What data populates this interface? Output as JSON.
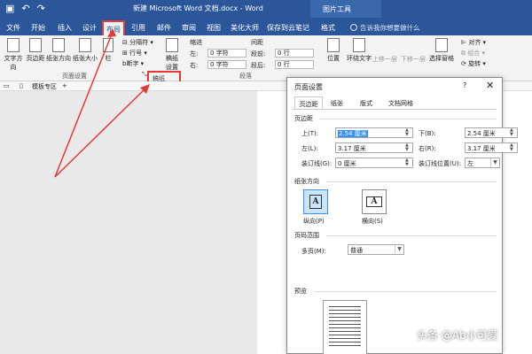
{
  "titlebar": {
    "title": "新建 Microsoft Word 文档.docx - Word",
    "tools_tab": "图片工具"
  },
  "tabs": [
    "文件",
    "开始",
    "插入",
    "设计",
    "布局",
    "引用",
    "邮件",
    "审阅",
    "视图",
    "美化大师",
    "保存到云笔记",
    "格式"
  ],
  "tell_me": "告诉我你想要做什么",
  "ribbon": {
    "buttons": {
      "text_direction": "文字方向",
      "margins": "页边距",
      "orientation": "纸张方向",
      "size": "纸张大小",
      "columns": "栏",
      "breaks": "分隔符",
      "line_numbers": "行号",
      "hyphenation": "断字",
      "draft_settings": "稿纸\n设置",
      "position": "位置",
      "wrap_text": "环绕文字",
      "bring_forward": "上移一层",
      "send_backward": "下移一层",
      "selection_pane": "选择窗格",
      "align": "对齐",
      "group": "组合",
      "rotate": "旋转"
    },
    "indent_label": "缩进",
    "spacing_label": "间距",
    "left_label": "左:",
    "right_label": "右:",
    "before_label": "段前:",
    "after_label": "段后:",
    "indent_left": "0 字符",
    "indent_right": "0 字符",
    "space_before": "0 行",
    "space_after": "0 行",
    "groups": {
      "page_setup": "页面设置",
      "draft": "稿纸",
      "paragraph": "段落"
    },
    "launcher_label": "稿纸"
  },
  "doctabs": {
    "home": "模板专区",
    "add": "+"
  },
  "dialog": {
    "title": "页面设置",
    "help": "?",
    "close": "✕",
    "tabs": [
      "页边距",
      "纸张",
      "版式",
      "文档网格"
    ],
    "margins_section": "页边距",
    "fields": {
      "top_label": "上(T):",
      "top_value": "2.54 厘米",
      "bottom_label": "下(B):",
      "bottom_value": "2.54 厘米",
      "left_label": "左(L):",
      "left_value": "3.17 厘米",
      "right_label": "右(R):",
      "right_value": "3.17 厘米",
      "gutter_label": "装订线(G):",
      "gutter_value": "0 厘米",
      "gutter_pos_label": "装订线位置(U):",
      "gutter_pos_value": "左"
    },
    "orientation_section": "纸张方向",
    "portrait": "纵向(P)",
    "landscape": "横向(S)",
    "pages_section": "页码范围",
    "multiple_pages_label": "多页(M):",
    "multiple_pages_value": "普通",
    "preview_section": "预览"
  },
  "watermark": "头条 @Ab小可爱",
  "colors": {
    "word_blue": "#2b579a",
    "highlight_red": "#e53935",
    "selection_blue": "#3390ff"
  }
}
